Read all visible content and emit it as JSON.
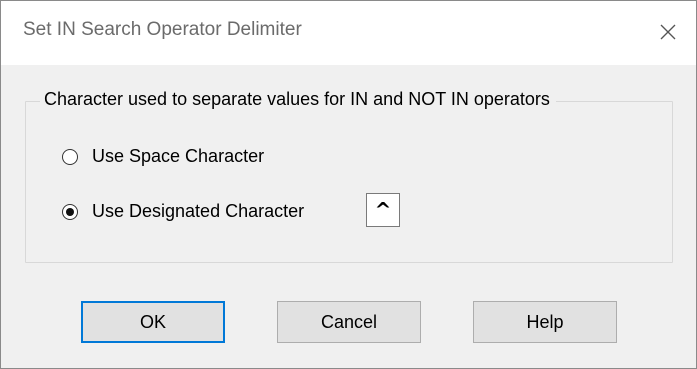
{
  "dialog": {
    "title": "Set IN Search Operator Delimiter",
    "close_icon": "close-icon"
  },
  "group": {
    "legend": "Character used to separate values for IN and NOT IN operators",
    "options": [
      {
        "label": "Use Space Character",
        "selected": false
      },
      {
        "label": "Use Designated Character",
        "selected": true
      }
    ],
    "designated_character": "^"
  },
  "buttons": {
    "ok": "OK",
    "cancel": "Cancel",
    "help": "Help"
  },
  "colors": {
    "default_button_border": "#0078d7",
    "dialog_background": "#f0f0f0",
    "titlebar_background": "#ffffff"
  }
}
